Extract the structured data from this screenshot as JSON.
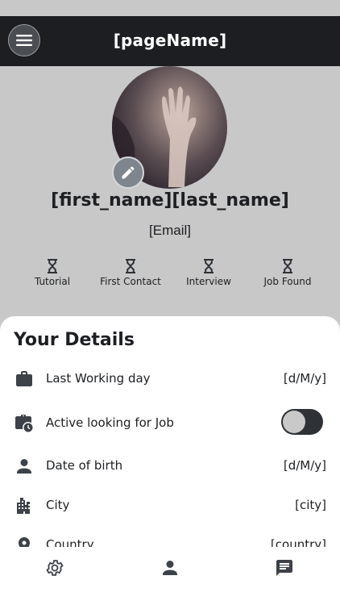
{
  "header": {
    "title": "[pageName]"
  },
  "profile": {
    "full_name": "[first_name][last_name]",
    "email": "[Email]"
  },
  "steps": [
    {
      "label": "Tutorial",
      "icon": "hourglass-icon"
    },
    {
      "label": "First Contact",
      "icon": "hourglass-icon"
    },
    {
      "label": "Interview",
      "icon": "hourglass-icon"
    },
    {
      "label": "Job Found",
      "icon": "hourglass-icon"
    }
  ],
  "details": {
    "title": "Your Details",
    "rows": [
      {
        "label": "Last Working day",
        "value": "[d/M/y]",
        "icon": "briefcase-icon"
      },
      {
        "label": "Active looking for Job",
        "icon": "work-history-icon",
        "toggle_on": false
      },
      {
        "label": "Date of birth",
        "value": "[d/M/y]",
        "icon": "person-icon"
      },
      {
        "label": "City",
        "value": "[city]",
        "icon": "city-icon"
      },
      {
        "label": "Country",
        "value": "[country]",
        "icon": "location-pin-icon"
      }
    ]
  },
  "nav": {
    "icons": [
      "gear-icon",
      "person-icon",
      "chat-icon"
    ]
  },
  "colors": {
    "topbar": "#1c1e21",
    "background": "#c8c8c8",
    "card": "#ffffff",
    "icon": "#3d4248"
  }
}
